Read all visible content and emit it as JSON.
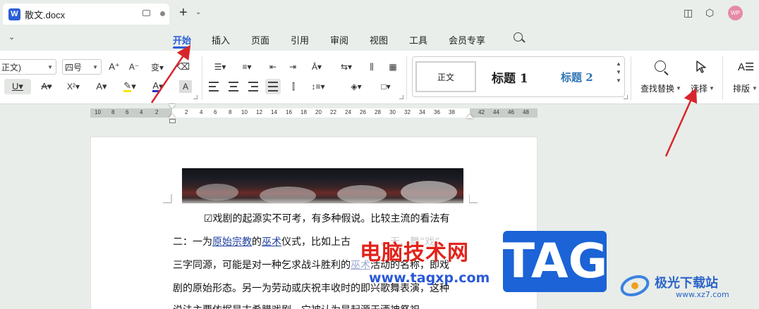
{
  "window": {
    "tab_title": "散文.docx",
    "app_logo_letter": "W",
    "avatar_text": "WP"
  },
  "menu": {
    "items": [
      "开始",
      "插入",
      "页面",
      "引用",
      "审阅",
      "视图",
      "工具",
      "会员专享"
    ],
    "active": "开始",
    "accent_color": "#2b5fd9"
  },
  "ribbon": {
    "font_name": "正文)",
    "font_size": "四号",
    "styles": {
      "normal": "正文",
      "heading1": "标题 1",
      "heading2": "标题 2"
    },
    "find_replace_label": "查找替换",
    "select_label": "选择",
    "layout_label": "排版"
  },
  "ruler": {
    "left_numbers": [
      "10",
      "8",
      "6",
      "4",
      "2"
    ],
    "body_numbers": [
      "2",
      "4",
      "6",
      "8",
      "10",
      "12",
      "14",
      "16",
      "18",
      "20",
      "22",
      "24",
      "26",
      "28",
      "30",
      "32",
      "34",
      "36",
      "38"
    ],
    "right_numbers": [
      "42",
      "44",
      "46",
      "48"
    ]
  },
  "document": {
    "lines": [
      "☑戏剧的起源实不可考，有多种假说。比较主流的看法有",
      "二：一为",
      "原始宗教",
      "的",
      "巫术",
      "仪式，比如上古",
      "三字同源，可能是对一种乞求战斗胜利的",
      "巫术",
      "活动的名称，即戏",
      "剧的原始形态。另一为劳动或庆祝丰收时的即兴歌舞表演，这种",
      "说法主要依据是古希腊戏剧，它被认为是起源于酒神祭祀"
    ],
    "partial_text": "、无、舞“戏”"
  },
  "watermarks": {
    "red_text": "电脑技术网",
    "url": "www.tagxp.com",
    "tag": "TAG",
    "site_name": "极光下载站",
    "site_url": "www.xz7.com"
  }
}
